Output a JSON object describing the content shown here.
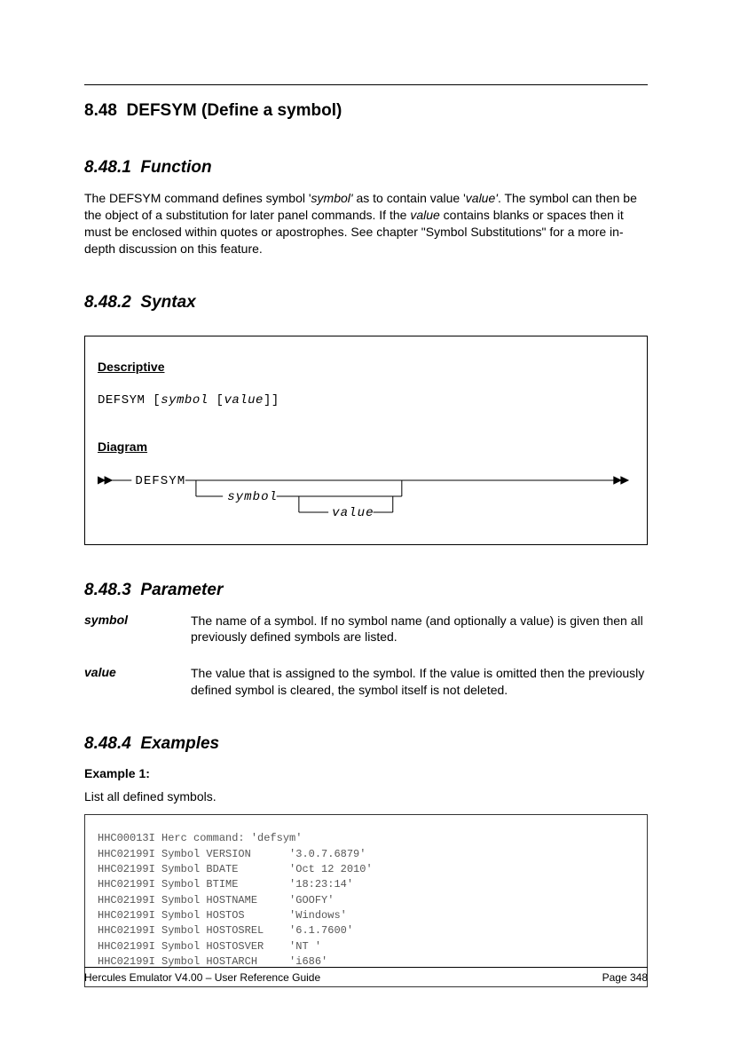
{
  "section": {
    "number": "8.48",
    "title": "DEFSYM (Define a symbol)"
  },
  "function": {
    "heading_num": "8.48.1",
    "heading": "Function",
    "body_pre": "The DEFSYM command defines symbol '",
    "body_sym": "symbol'",
    "body_mid": " as to contain value '",
    "body_val": "value'",
    "body_post1": ". The symbol can then be the object of a substitution for later panel commands. If the ",
    "body_val2": "value",
    "body_post2": " contains blanks or spaces then it must be enclosed within quotes or apostrophes. See chapter \"Symbol Substitutions\" for a more in-depth discussion on this feature."
  },
  "syntax": {
    "heading_num": "8.48.2",
    "heading": "Syntax",
    "label_descriptive": "Descriptive",
    "cmd": "DEFSYM [",
    "arg1": "symbol",
    "mid": " [",
    "arg2": "value",
    "end": "]]",
    "label_diagram": "Diagram",
    "diag_cmd": "DEFSYM",
    "diag_arg1": "symbol",
    "diag_arg2": "value"
  },
  "parameter": {
    "heading_num": "8.48.3",
    "heading": "Parameter",
    "rows": [
      {
        "name": "symbol",
        "desc": "The name of a symbol. If no symbol name (and optionally a value) is given then all previously defined symbols are listed."
      },
      {
        "name": "value",
        "desc": "The value that is assigned to the symbol. If the value is omitted then the previously defined symbol is cleared, the symbol itself is not deleted."
      }
    ]
  },
  "examples": {
    "heading_num": "8.48.4",
    "heading": "Examples",
    "ex1_label": "Example 1:",
    "ex1_desc": "List all defined symbols.",
    "code": "HHC00013I Herc command: 'defsym'\nHHC02199I Symbol VERSION      '3.0.7.6879'\nHHC02199I Symbol BDATE        'Oct 12 2010'\nHHC02199I Symbol BTIME        '18:23:14'\nHHC02199I Symbol HOSTNAME     'GOOFY'\nHHC02199I Symbol HOSTOS       'Windows'\nHHC02199I Symbol HOSTOSREL    '6.1.7600'\nHHC02199I Symbol HOSTOSVER    'NT '\nHHC02199I Symbol HOSTARCH     'i686'"
  },
  "footer": {
    "left": "Hercules Emulator V4.00 – User Reference Guide",
    "right": "Page 348"
  }
}
